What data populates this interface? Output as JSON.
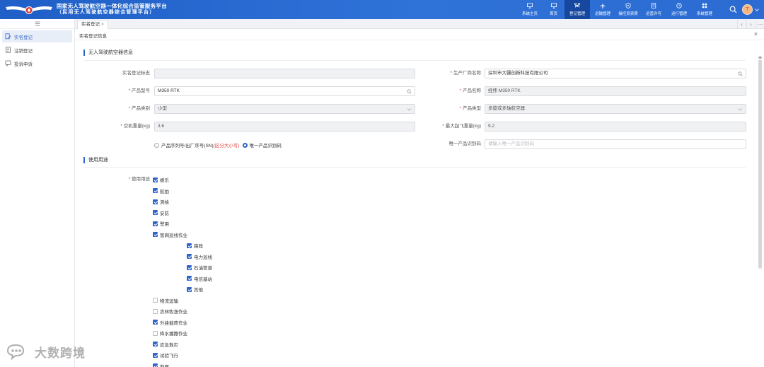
{
  "header": {
    "title_line1": "国家无人驾驶航空器一体化综合监管服务平台",
    "title_line2": "（民用无人驾驶航空器综合管理平台）",
    "nav": [
      {
        "label": "系统主页",
        "icon": "monitor-icon"
      },
      {
        "label": "首页",
        "icon": "monitor-icon"
      },
      {
        "label": "登记管理",
        "icon": "drone-icon",
        "active": true
      },
      {
        "label": "运输管理",
        "icon": "plane-icon"
      },
      {
        "label": "操控员资质",
        "icon": "shield-icon"
      },
      {
        "label": "运营许可",
        "icon": "document-icon"
      },
      {
        "label": "运行管理",
        "icon": "clock-icon"
      },
      {
        "label": "系统管理",
        "icon": "grid-icon"
      }
    ],
    "avatar_letter": "T"
  },
  "sidebar": {
    "items": [
      {
        "label": "实名登记",
        "active": true
      },
      {
        "label": "注销登记"
      },
      {
        "label": "投诉申诉"
      }
    ]
  },
  "tabs": [
    {
      "label": "实名登记",
      "close": "×"
    }
  ],
  "breadcrumb": "实名登记信息",
  "section1": {
    "title": "无人驾驶航空器信息",
    "fields": {
      "reg_label": "实名登记标志",
      "reg_value": "",
      "manufacturer_label": "生产厂商名称",
      "manufacturer_value": "深圳市大疆创新科技有限公司",
      "model_label": "产品型号",
      "model_value": "M350 RTK",
      "product_name_label": "产品名称",
      "product_name_value": "经纬 M350 RTK",
      "category_label": "产品类别",
      "category_value": "小型",
      "type_label": "产品类型",
      "type_value": "多旋或多轴航空器",
      "empty_weight_label": "空机重量(kg)",
      "empty_weight_value": "3.6",
      "mtow_label": "最大起飞重量(kg)",
      "mtow_value": "9.2",
      "radio_serial_label": "产品序列号/出厂序号(SN)",
      "radio_serial_note": "(区分大小写)",
      "radio_unique_label": "唯一产品识别码",
      "unique_code_label": "唯一产品识别码",
      "unique_code_placeholder": "请输入唯一产品识别码"
    }
  },
  "section2": {
    "title": "使用用途",
    "field_label": "使用用途",
    "items": [
      {
        "label": "娱乐",
        "checked": true,
        "level": 0
      },
      {
        "label": "航拍",
        "checked": true,
        "level": 0
      },
      {
        "label": "测绘",
        "checked": true,
        "level": 0
      },
      {
        "label": "安防",
        "checked": true,
        "level": 0
      },
      {
        "label": "警用",
        "checked": true,
        "level": 0
      },
      {
        "label": "管网巡线作业",
        "checked": true,
        "level": 0
      },
      {
        "label": "路政",
        "checked": true,
        "level": 1
      },
      {
        "label": "电力巡线",
        "checked": true,
        "level": 1
      },
      {
        "label": "石油管道",
        "checked": true,
        "level": 1
      },
      {
        "label": "电信基站",
        "checked": true,
        "level": 1
      },
      {
        "label": "其他",
        "checked": true,
        "level": 1
      },
      {
        "label": "物流运输",
        "checked": false,
        "level": 0
      },
      {
        "label": "农林牧渔作业",
        "checked": false,
        "level": 0
      },
      {
        "label": "外挂载荷作业",
        "checked": true,
        "level": 0
      },
      {
        "label": "降水播撒作业",
        "checked": false,
        "level": 0
      },
      {
        "label": "应急救灾",
        "checked": true,
        "level": 0
      },
      {
        "label": "试验飞行",
        "checked": true,
        "level": 0
      },
      {
        "label": "勘察",
        "checked": true,
        "level": 0
      }
    ]
  },
  "watermark": "大数跨境",
  "colors": {
    "primary": "#2f64c8",
    "header": "#2b6bd2",
    "required": "#e23b3b"
  }
}
